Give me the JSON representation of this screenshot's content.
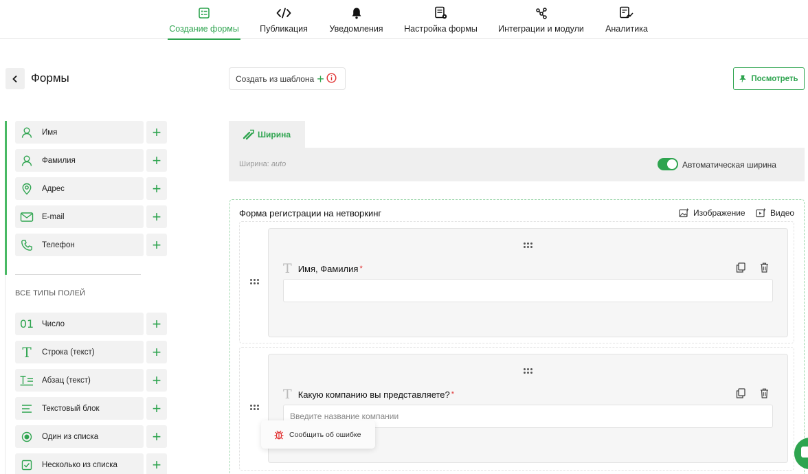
{
  "nav": {
    "tabs": [
      {
        "label": "Создание формы",
        "icon": "form-icon",
        "active": true
      },
      {
        "label": "Публикация",
        "icon": "code-icon"
      },
      {
        "label": "Уведомления",
        "icon": "bell-icon"
      },
      {
        "label": "Настройка формы",
        "icon": "settings-doc-icon"
      },
      {
        "label": "Интеграции и модули",
        "icon": "integrations-icon"
      },
      {
        "label": "Аналитика",
        "icon": "analytics-icon"
      }
    ]
  },
  "header": {
    "title": "Формы",
    "template_button": "Создать из шаблона",
    "view_button": "Посмотреть"
  },
  "sidebar": {
    "quick_fields": [
      {
        "label": "Имя",
        "icon": "user-icon"
      },
      {
        "label": "Фамилия",
        "icon": "user-icon"
      },
      {
        "label": "Адрес",
        "icon": "location-icon"
      },
      {
        "label": "E-mail",
        "icon": "mail-icon"
      },
      {
        "label": "Телефон",
        "icon": "phone-icon"
      }
    ],
    "all_types_heading": "ВСЕ ТИПЫ ПОЛЕЙ",
    "field_types": [
      {
        "label": "Число",
        "icon": "number-icon"
      },
      {
        "label": "Строка (текст)",
        "icon": "text-icon"
      },
      {
        "label": "Абзац (текст)",
        "icon": "paragraph-icon"
      },
      {
        "label": "Текстовый блок",
        "icon": "text-block-icon"
      },
      {
        "label": "Один из списка",
        "icon": "radio-icon"
      },
      {
        "label": "Несколько из списка",
        "icon": "checkbox-icon"
      }
    ]
  },
  "width": {
    "tab_label": "Ширина",
    "label_prefix": "Ширина:",
    "value": "auto",
    "auto_toggle_label": "Автоматическая ширина",
    "auto_enabled": true
  },
  "form": {
    "title": "Форма регистрации на нетворкинг",
    "image_label": "Изображение",
    "video_label": "Видео",
    "questions": [
      {
        "title": "Имя, Фамилия",
        "required_mark": "*",
        "placeholder": ""
      },
      {
        "title": "Какую компанию вы представляете?",
        "required_mark": "*",
        "placeholder": "Введите название компании"
      }
    ]
  },
  "toast": {
    "label": "Сообщить об ошибке"
  },
  "colors": {
    "accent": "#2ea44f",
    "required": "#e03030"
  }
}
